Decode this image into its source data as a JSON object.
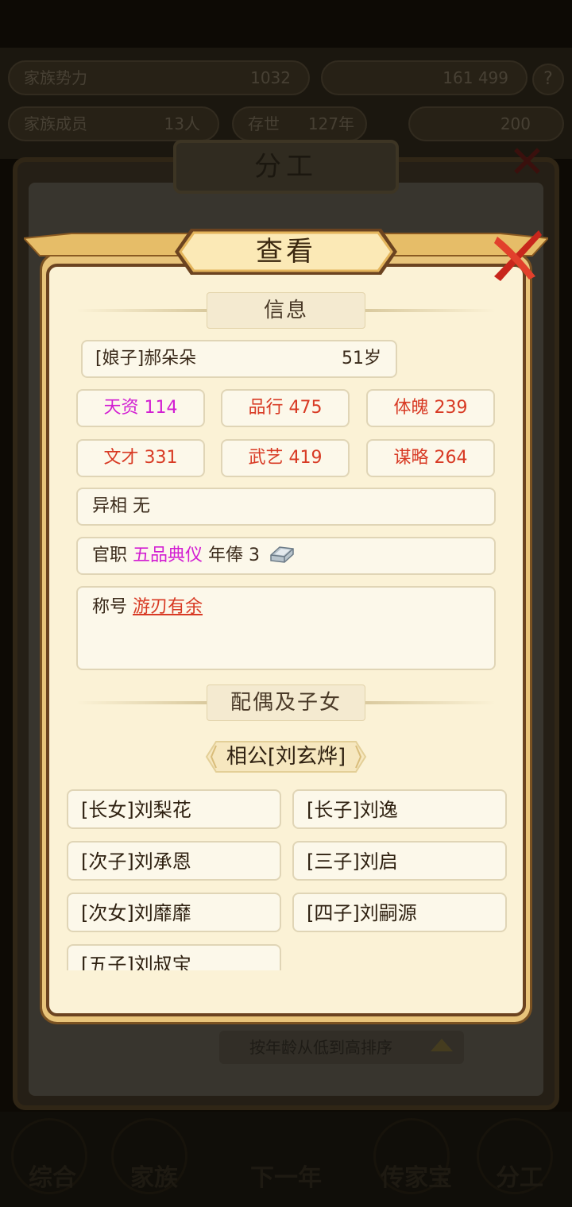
{
  "background": {
    "top_stats": [
      {
        "label": "家族势力",
        "value": "1032"
      },
      {
        "label": "",
        "value": "161 499"
      }
    ],
    "second_stats": [
      {
        "label": "家族成员",
        "value": "13人"
      },
      {
        "label": "存世",
        "value": "127年"
      },
      {
        "label": "",
        "value": "200"
      }
    ],
    "help_icon": "?",
    "panel_title": "分工",
    "sort_label": "按年龄从低到高排序",
    "nav": [
      "综合",
      "家族",
      "下一年",
      "传家宝",
      "分工"
    ]
  },
  "dialog": {
    "title": "查看",
    "info_heading": "信息",
    "person": {
      "name": "[娘子]郝朵朵",
      "age": "51岁"
    },
    "stats": [
      {
        "text": "天资 114",
        "color": "pink"
      },
      {
        "text": "品行 475",
        "color": "red"
      },
      {
        "text": "体魄 239",
        "color": "red"
      },
      {
        "text": "文才 331",
        "color": "red"
      },
      {
        "text": "武艺 419",
        "color": "red"
      },
      {
        "text": "谋略 264",
        "color": "red"
      }
    ],
    "trait": {
      "label": "异相",
      "value": "无"
    },
    "office": {
      "label": "官职",
      "rank": "五品典仪",
      "salary_label": "年俸",
      "salary": "3"
    },
    "honor": {
      "label": "称号",
      "value": "游刃有余"
    },
    "family_heading": "配偶及子女",
    "spouse": "相公[刘玄烨]",
    "children": [
      "[长女]刘梨花",
      "[长子]刘逸",
      "[次子]刘承恩",
      "[三子]刘启",
      "[次女]刘靡靡",
      "[四子]刘嗣源",
      "[五子]刘叔宝"
    ]
  },
  "colors": {
    "pink": "#d21ed2",
    "red": "#d83a24",
    "panel": "#fbf2d6",
    "gold_border": "#e8c47a"
  }
}
